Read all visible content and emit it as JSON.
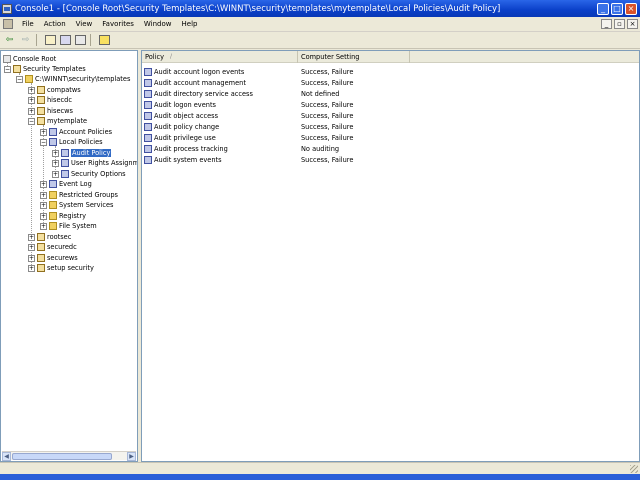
{
  "window": {
    "title": "Console1 - [Console Root\\Security Templates\\C:\\WINNT\\security\\templates\\mytemplate\\Local Policies\\Audit Policy]",
    "buttons": [
      "_",
      "□",
      "×"
    ]
  },
  "menubar": {
    "items": [
      "File",
      "Action",
      "View",
      "Favorites",
      "Window",
      "Help"
    ],
    "mdi_buttons": [
      "_",
      "▫",
      "×"
    ]
  },
  "toolbar": {
    "back": "⇦",
    "forward": "⇨"
  },
  "tree": {
    "items": [
      {
        "label": "Console Root"
      },
      {
        "label": "Security Templates"
      },
      {
        "label": "C:\\WINNT\\security\\templates"
      },
      {
        "label": "compatws"
      },
      {
        "label": "hisecdc"
      },
      {
        "label": "hisecws"
      },
      {
        "label": "mytemplate"
      },
      {
        "label": "Account Policies"
      },
      {
        "label": "Local Policies"
      },
      {
        "label": "Audit Policy"
      },
      {
        "label": "User Rights Assignme"
      },
      {
        "label": "Security Options"
      },
      {
        "label": "Event Log"
      },
      {
        "label": "Restricted Groups"
      },
      {
        "label": "System Services"
      },
      {
        "label": "Registry"
      },
      {
        "label": "File System"
      },
      {
        "label": "rootsec"
      },
      {
        "label": "securedc"
      },
      {
        "label": "securews"
      },
      {
        "label": "setup security"
      }
    ]
  },
  "list": {
    "columns": [
      "Policy",
      "Computer Setting"
    ],
    "sort_indicator": "/",
    "rows": [
      {
        "policy": "Audit account logon events",
        "setting": "Success, Failure"
      },
      {
        "policy": "Audit account management",
        "setting": "Success, Failure"
      },
      {
        "policy": "Audit directory service access",
        "setting": "Not defined"
      },
      {
        "policy": "Audit logon events",
        "setting": "Success, Failure"
      },
      {
        "policy": "Audit object access",
        "setting": "Success, Failure"
      },
      {
        "policy": "Audit policy change",
        "setting": "Success, Failure"
      },
      {
        "policy": "Audit privilege use",
        "setting": "Success, Failure"
      },
      {
        "policy": "Audit process tracking",
        "setting": "No auditing"
      },
      {
        "policy": "Audit system events",
        "setting": "Success, Failure"
      }
    ]
  },
  "colors": {
    "titlebar": "#0a3fc8",
    "selection": "#316ac5",
    "taskbar": "#2a5fd8"
  }
}
